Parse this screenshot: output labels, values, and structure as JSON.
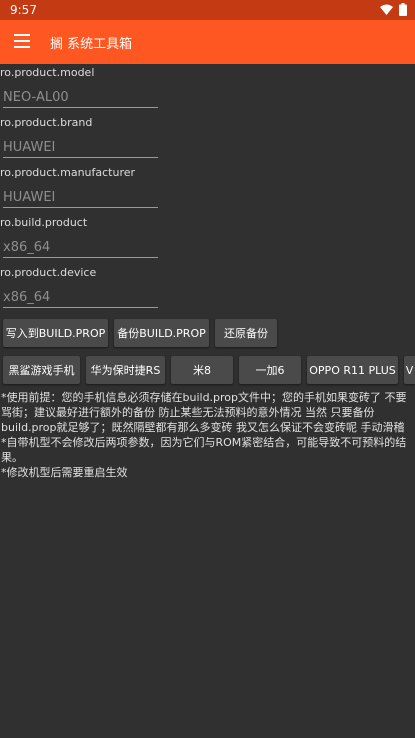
{
  "status_bar": {
    "time": "9:57"
  },
  "app_bar": {
    "title": "搁 系统工具箱"
  },
  "fields": [
    {
      "label": "ro.product.model",
      "value": "NEO-AL00"
    },
    {
      "label": "ro.product.brand",
      "value": "HUAWEI"
    },
    {
      "label": "ro.product.manufacturer",
      "value": "HUAWEI"
    },
    {
      "label": "ro.build.product",
      "value": "x86_64"
    },
    {
      "label": "ro.product.device",
      "value": "x86_64"
    }
  ],
  "actions": {
    "write": "写入到BUILD.PROP",
    "backup": "备份BUILD.PROP",
    "restore": "还原备份"
  },
  "presets": [
    "黑鲨游戏手机",
    "华为保时捷RS",
    "米8",
    "一加6",
    "OPPO R11 PLUS",
    "V"
  ],
  "notes": {
    "line1": "*使用前提：您的手机信息必须存储在build.prop文件中；您的手机如果变砖了 不要骂街；建议最好进行额外的备份 防止某些无法预料的意外情况 当然 只要备份build.prop就足够了；既然隔壁都有那么多变砖 我又怎么保证不会变砖呢 手动滑稽",
    "line2": "*自带机型不会修改后两项参数，因为它们与ROM紧密结合，可能导致不可预料的结果。",
    "line3": "*修改机型后需要重启生效"
  }
}
